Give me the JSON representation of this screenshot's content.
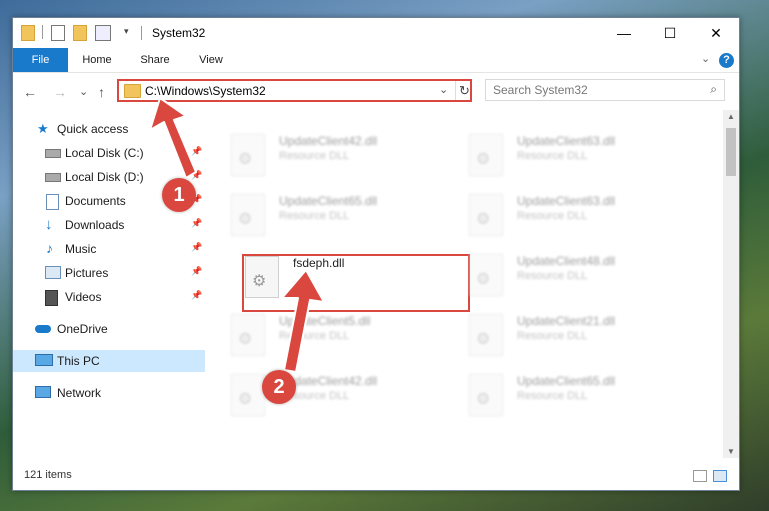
{
  "window": {
    "title": "System32",
    "minimize": "—",
    "maximize": "☐",
    "close": "✕"
  },
  "ribbon": {
    "tabs": [
      "File",
      "Home",
      "Share",
      "View"
    ],
    "expand": "⌄",
    "help": "?"
  },
  "navbar": {
    "back": "←",
    "forward": "→",
    "recent": "⌄",
    "up": "↑",
    "address": "C:\\Windows\\System32",
    "address_dropdown": "⌄",
    "refresh": "↻",
    "search_placeholder": "Search System32",
    "search_icon": "⌕"
  },
  "sidebar": {
    "items": [
      {
        "label": "Quick access",
        "icon": "star-icon",
        "pinned": false
      },
      {
        "label": "Local Disk (C:)",
        "icon": "drive-icon",
        "pinned": true
      },
      {
        "label": "Local Disk (D:)",
        "icon": "drive-icon",
        "pinned": true
      },
      {
        "label": "Documents",
        "icon": "documents-icon",
        "pinned": true
      },
      {
        "label": "Downloads",
        "icon": "downloads-icon",
        "pinned": true
      },
      {
        "label": "Music",
        "icon": "music-icon",
        "pinned": true
      },
      {
        "label": "Pictures",
        "icon": "pictures-icon",
        "pinned": true
      },
      {
        "label": "Videos",
        "icon": "videos-icon",
        "pinned": true
      },
      {
        "label": "OneDrive",
        "icon": "onedrive-icon",
        "pinned": false
      },
      {
        "label": "This PC",
        "icon": "pc-icon",
        "pinned": false,
        "selected": true
      },
      {
        "label": "Network",
        "icon": "network-icon",
        "pinned": false
      }
    ],
    "pin_glyph": "📌"
  },
  "files": {
    "left": [
      {
        "name": "UpdateClient42.dll",
        "type": "Resource DLL"
      },
      {
        "name": "UpdateClient65.dll",
        "type": "Resource DLL"
      },
      {
        "name": "fsdeph.dll",
        "type": ""
      },
      {
        "name": "UpdateClient5.dll",
        "type": "Resource DLL"
      },
      {
        "name": "UpdateClient42.dll",
        "type": "Resource DLL"
      }
    ],
    "right": [
      {
        "name": "UpdateClient63.dll",
        "type": "Resource DLL"
      },
      {
        "name": "UpdateClient63.dll",
        "type": "Resource DLL"
      },
      {
        "name": "UpdateClient48.dll",
        "type": "Resource DLL"
      },
      {
        "name": "UpdateClient21.dll",
        "type": "Resource DLL"
      },
      {
        "name": "UpdateClient65.dll",
        "type": "Resource DLL"
      }
    ],
    "gear_glyph": "⚙"
  },
  "status": {
    "count": "121 items"
  },
  "annotations": {
    "step1": "1",
    "step2": "2"
  },
  "colors": {
    "accent": "#1979ca",
    "highlight": "#d9473f",
    "selected": "#cce8ff"
  }
}
